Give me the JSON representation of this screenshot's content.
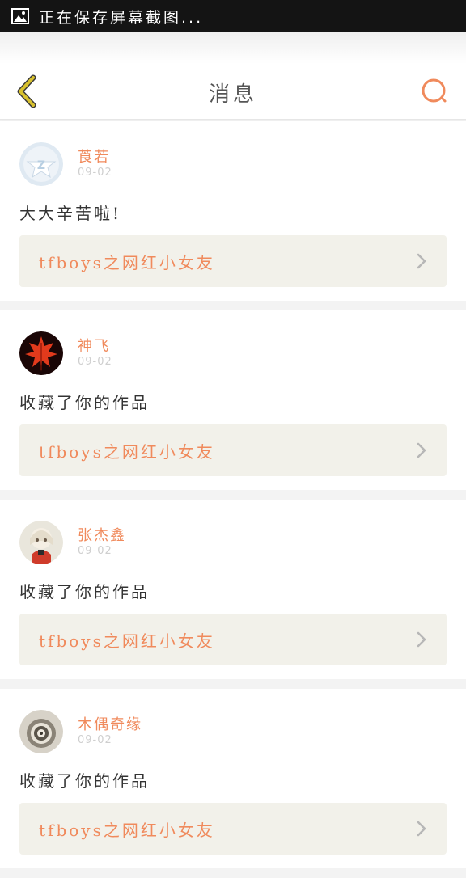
{
  "status_bar": {
    "text": "正在保存屏幕截图...",
    "icon": "image-icon"
  },
  "header": {
    "title": "消息",
    "back_icon": "chevron-left-icon",
    "search_icon": "search-icon",
    "accent_color": "#f08a5c",
    "back_color": "#c9b227"
  },
  "messages": [
    {
      "name": "莨若",
      "date": "09-02",
      "text": "大大辛苦啦!",
      "work": "tfboys之网红小女友",
      "avatar": "default-avatar"
    },
    {
      "name": "神飞",
      "date": "09-02",
      "text": "收藏了你的作品",
      "work": "tfboys之网红小女友",
      "avatar": "maple-leaf-avatar"
    },
    {
      "name": "张杰鑫",
      "date": "09-02",
      "text": "收藏了你的作品",
      "work": "tfboys之网红小女友",
      "avatar": "doll-avatar"
    },
    {
      "name": "木偶奇缘",
      "date": "09-02",
      "text": "收藏了你的作品",
      "work": "tfboys之网红小女友",
      "avatar": "spiral-avatar"
    }
  ]
}
